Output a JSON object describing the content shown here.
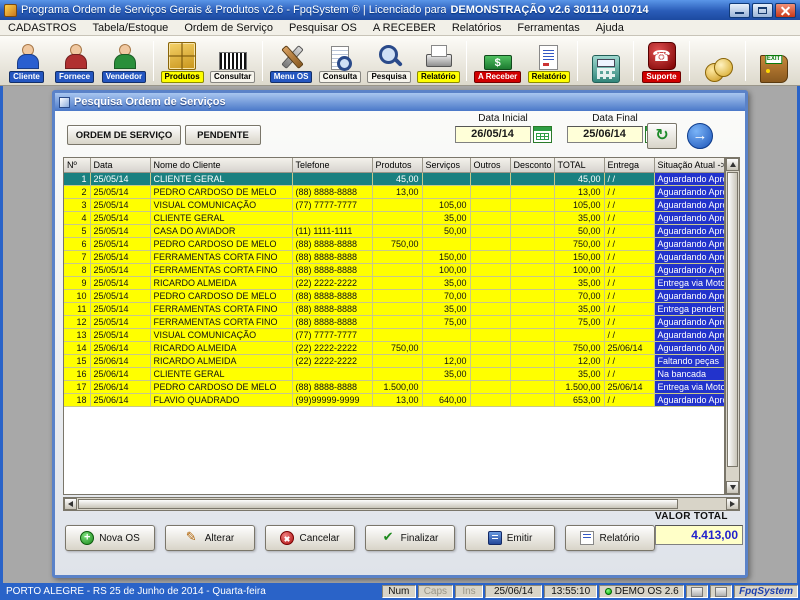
{
  "titlebar": {
    "title": "Programa Ordem de Serviços Gerais & Produtos v2.6 - FpqSystem ® | Licenciado para",
    "license": "DEMONSTRAÇÃO v2.6 301114 010714"
  },
  "menubar": {
    "items": [
      "CADASTROS",
      "Tabela/Estoque",
      "Ordem de Serviço",
      "Pesquisar OS",
      "A RECEBER",
      "Relatórios",
      "Ferramentas",
      "Ajuda"
    ]
  },
  "toolbar": {
    "items": [
      {
        "label": "Cliente",
        "icon": "client-icon",
        "chip": "blue"
      },
      {
        "label": "Fornece",
        "icon": "supplier-icon",
        "chip": "blue"
      },
      {
        "label": "Vendedor",
        "icon": "seller-icon",
        "chip": "blue",
        "sep_after": true
      },
      {
        "label": "Produtos",
        "icon": "products-icon",
        "chip": "yellow"
      },
      {
        "label": "Consultar",
        "icon": "barcode-icon",
        "chip": "silver",
        "sep_after": true
      },
      {
        "label": "Menu OS",
        "icon": "tools-icon",
        "chip": "blue"
      },
      {
        "label": "Consulta",
        "icon": "doc-search-icon",
        "chip": "silver"
      },
      {
        "label": "Pesquisa",
        "icon": "search-icon",
        "chip": "silver"
      },
      {
        "label": "Relatório",
        "icon": "printer-icon",
        "chip": "yellow",
        "sep_after": true
      },
      {
        "label": "A Receber",
        "icon": "money-icon",
        "chip": "red"
      },
      {
        "label": "Relatório",
        "icon": "report-icon",
        "chip": "yellow",
        "sep_after": true
      },
      {
        "label": "",
        "icon": "calculator-icon",
        "chip": "none",
        "sep_after": true
      },
      {
        "label": "Suporte",
        "icon": "support-icon",
        "chip": "red",
        "sep_after": true
      },
      {
        "label": "",
        "icon": "coins-icon",
        "chip": "none",
        "sep_after": true
      },
      {
        "label": "",
        "icon": "exit-icon",
        "chip": "none",
        "badge": "EXIT"
      }
    ]
  },
  "child_window": {
    "title": "Pesquisa Ordem de Serviços",
    "ordem_label": "ORDEM DE SERVIÇO",
    "pendente_label": "PENDENTE",
    "date_initial": {
      "label": "Data Inicial",
      "value": "26/05/14"
    },
    "date_final": {
      "label": "Data Final",
      "value": "25/06/14"
    }
  },
  "table": {
    "columns": [
      "Nº",
      "Data",
      "Nome do Cliente",
      "Telefone",
      "Produtos",
      "Serviços",
      "Outros",
      "Desconto",
      "TOTAL",
      "Entrega",
      "Situação Atual ->"
    ],
    "rows": [
      {
        "n": "1",
        "date": "25/05/14",
        "client": "CLIENTE GERAL",
        "phone": "",
        "products": "45,00",
        "services": "",
        "others": "",
        "discount": "",
        "total": "45,00",
        "delivery": "/ /",
        "status": "Aguardando Aprovação",
        "selected": true
      },
      {
        "n": "2",
        "date": "25/05/14",
        "client": "PEDRO CARDOSO DE MELO",
        "phone": "(88) 8888-8888",
        "products": "13,00",
        "services": "",
        "others": "",
        "discount": "",
        "total": "13,00",
        "delivery": "/ /",
        "status": "Aguardando Aprovação"
      },
      {
        "n": "3",
        "date": "25/05/14",
        "client": "VISUAL COMUNICAÇÃO",
        "phone": "(77) 7777-7777",
        "products": "",
        "services": "105,00",
        "others": "",
        "discount": "",
        "total": "105,00",
        "delivery": "/ /",
        "status": "Aguardando Aprovação"
      },
      {
        "n": "4",
        "date": "25/05/14",
        "client": "CLIENTE GERAL",
        "phone": "",
        "products": "",
        "services": "35,00",
        "others": "",
        "discount": "",
        "total": "35,00",
        "delivery": "/ /",
        "status": "Aguardando Aprovação"
      },
      {
        "n": "5",
        "date": "25/05/14",
        "client": "CASA DO AVIADOR",
        "phone": "(11) 1111-1111",
        "products": "",
        "services": "50,00",
        "others": "",
        "discount": "",
        "total": "50,00",
        "delivery": "/ /",
        "status": "Aguardando Aprovação"
      },
      {
        "n": "6",
        "date": "25/05/14",
        "client": "PEDRO CARDOSO DE MELO",
        "phone": "(88) 8888-8888",
        "products": "750,00",
        "services": "",
        "others": "",
        "discount": "",
        "total": "750,00",
        "delivery": "/ /",
        "status": "Aguardando Aprovação"
      },
      {
        "n": "7",
        "date": "25/05/14",
        "client": "FERRAMENTAS CORTA FINO",
        "phone": "(88) 8888-8888",
        "products": "",
        "services": "150,00",
        "others": "",
        "discount": "",
        "total": "150,00",
        "delivery": "/ /",
        "status": "Aguardando Aprovação"
      },
      {
        "n": "8",
        "date": "25/05/14",
        "client": "FERRAMENTAS CORTA FINO",
        "phone": "(88) 8888-8888",
        "products": "",
        "services": "100,00",
        "others": "",
        "discount": "",
        "total": "100,00",
        "delivery": "/ /",
        "status": "Aguardando Aprovação"
      },
      {
        "n": "9",
        "date": "25/05/14",
        "client": "RICARDO ALMEIDA",
        "phone": "(22) 2222-2222",
        "products": "",
        "services": "35,00",
        "others": "",
        "discount": "",
        "total": "35,00",
        "delivery": "/ /",
        "status": "Entrega via Motoboy"
      },
      {
        "n": "10",
        "date": "25/05/14",
        "client": "PEDRO CARDOSO DE MELO",
        "phone": "(88) 8888-8888",
        "products": "",
        "services": "70,00",
        "others": "",
        "discount": "",
        "total": "70,00",
        "delivery": "/ /",
        "status": "Aguardando Aprovação"
      },
      {
        "n": "11",
        "date": "25/05/14",
        "client": "FERRAMENTAS CORTA FINO",
        "phone": "(88) 8888-8888",
        "products": "",
        "services": "35,00",
        "others": "",
        "discount": "",
        "total": "35,00",
        "delivery": "/ /",
        "status": "Entrega pendente"
      },
      {
        "n": "12",
        "date": "25/05/14",
        "client": "FERRAMENTAS CORTA FINO",
        "phone": "(88) 8888-8888",
        "products": "",
        "services": "75,00",
        "others": "",
        "discount": "",
        "total": "75,00",
        "delivery": "/ /",
        "status": "Aguardando Aprovação"
      },
      {
        "n": "13",
        "date": "25/05/14",
        "client": "VISUAL COMUNICAÇÃO",
        "phone": "(77) 7777-7777",
        "products": "",
        "services": "",
        "others": "",
        "discount": "",
        "total": "",
        "delivery": "/ /",
        "status": "Aguardando Aprovação"
      },
      {
        "n": "14",
        "date": "25/06/14",
        "client": "RICARDO ALMEIDA",
        "phone": "(22) 2222-2222",
        "products": "750,00",
        "services": "",
        "others": "",
        "discount": "",
        "total": "750,00",
        "delivery": "25/06/14",
        "status": "Aguardando Aprovação"
      },
      {
        "n": "15",
        "date": "25/06/14",
        "client": "RICARDO ALMEIDA",
        "phone": "(22) 2222-2222",
        "products": "",
        "services": "12,00",
        "others": "",
        "discount": "",
        "total": "12,00",
        "delivery": "/ /",
        "status": "Faltando peças"
      },
      {
        "n": "16",
        "date": "25/06/14",
        "client": "CLIENTE GERAL",
        "phone": "",
        "products": "",
        "services": "35,00",
        "others": "",
        "discount": "",
        "total": "35,00",
        "delivery": "/ /",
        "status": "Na bancada"
      },
      {
        "n": "17",
        "date": "25/06/14",
        "client": "PEDRO CARDOSO DE MELO",
        "phone": "(88) 8888-8888",
        "products": "1.500,00",
        "services": "",
        "others": "",
        "discount": "",
        "total": "1.500,00",
        "delivery": "25/06/14",
        "status": "Entrega via Motoboy"
      },
      {
        "n": "18",
        "date": "25/06/14",
        "client": "FLAVIO QUADRADO",
        "phone": "(99)99999-9999",
        "products": "13,00",
        "services": "640,00",
        "others": "",
        "discount": "",
        "total": "653,00",
        "delivery": "/ /",
        "status": "Aguardando Aprovação"
      }
    ]
  },
  "actions": {
    "buttons": [
      {
        "label": "Nova OS",
        "icon": "new-icon"
      },
      {
        "label": "Alterar",
        "icon": "edit-icon"
      },
      {
        "label": "Cancelar",
        "icon": "cancel-icon"
      },
      {
        "label": "Finalizar",
        "icon": "finish-icon"
      },
      {
        "label": "Emitir",
        "icon": "emit-icon"
      },
      {
        "label": "Relatório",
        "icon": "rep-icon"
      }
    ],
    "total_label": "VALOR TOTAL",
    "total_value": "4.413,00"
  },
  "statusbar": {
    "location": "PORTO ALEGRE - RS 25 de Junho de 2014 - Quarta-feira",
    "num": "Num",
    "caps": "Caps",
    "ins": "Ins",
    "date": "25/06/14",
    "time": "13:55:10",
    "demo": "DEMO OS 2.6",
    "brand": "FpqSystem"
  },
  "colors": {
    "row_yellow": "#ffff00",
    "status_cell_blue": "#2233cc",
    "selected_teal": "#1a8080",
    "total_text_blue": "#2222cc",
    "titlebar_blue": "#2a5cb8"
  }
}
